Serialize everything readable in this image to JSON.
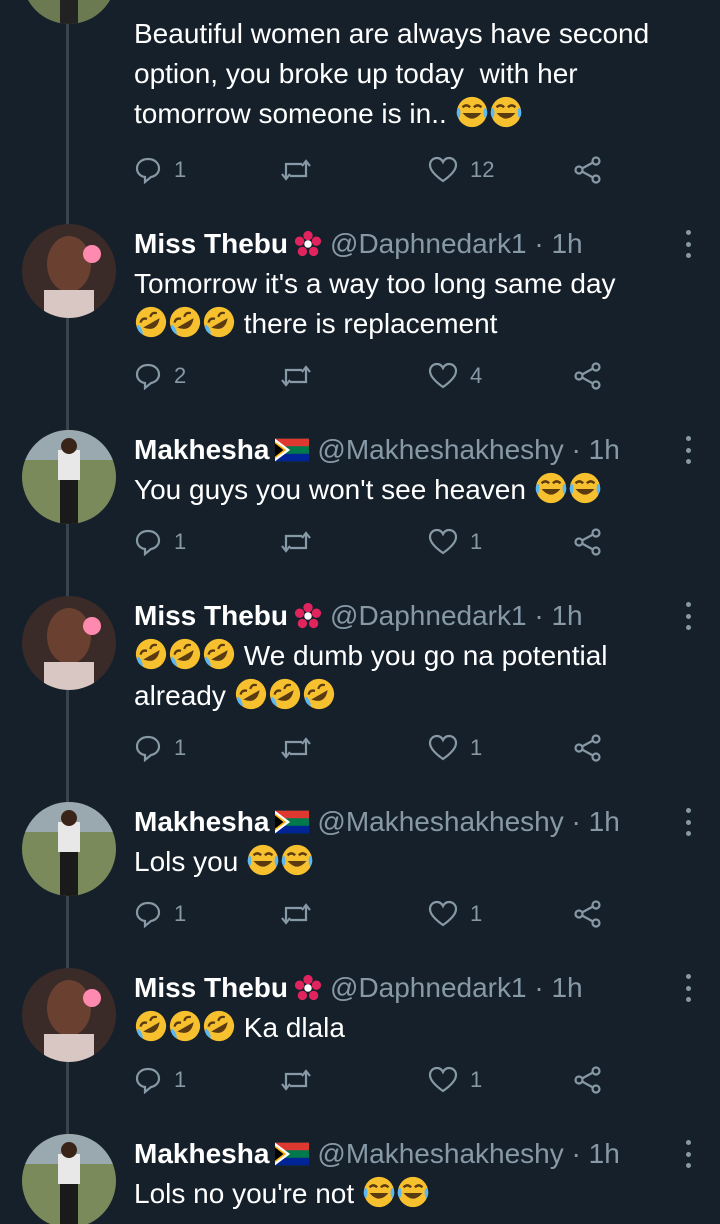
{
  "top_tweet": {
    "text_before": "Beautiful women are always have second\noption, you broke up today  with her\ntomorrow someone is in.. ",
    "emoji_after": [
      "face-with-tears-of-joy",
      "face-with-tears-of-joy"
    ],
    "replies": "1",
    "retweets": "",
    "likes": "12"
  },
  "tweets": [
    {
      "name": "Miss Thebu",
      "badge": "hibiscus-flower",
      "handle": "@Daphnedark1 · 1h",
      "line1": "Tomorrow it's a way too long same day",
      "line2_prefix_emoji": [
        "rofl",
        "rofl",
        "rofl"
      ],
      "line2_text": " there is replacement",
      "replies": "2",
      "likes": "4"
    },
    {
      "name": "Makhesha",
      "badge": "south-africa-flag",
      "handle": "@Makheshakheshy · 1h",
      "text": "You guys you won't see heaven ",
      "emoji_after": [
        "face-with-tears-of-joy",
        "face-with-tears-of-joy"
      ],
      "replies": "1",
      "likes": "1"
    },
    {
      "name": "Miss Thebu",
      "badge": "hibiscus-flower",
      "handle": "@Daphnedark1 · 1h",
      "line1_prefix_emoji": [
        "rofl",
        "rofl",
        "rofl"
      ],
      "line1_text": " We dumb you go na potential",
      "line2_text": "already ",
      "line2_emoji": [
        "rofl",
        "rofl",
        "rofl"
      ],
      "replies": "1",
      "likes": "1"
    },
    {
      "name": "Makhesha",
      "badge": "south-africa-flag",
      "handle": "@Makheshakheshy · 1h",
      "text": "Lols you ",
      "emoji_after": [
        "face-with-tears-of-joy",
        "face-with-tears-of-joy"
      ],
      "replies": "1",
      "likes": "1"
    },
    {
      "name": "Miss Thebu",
      "badge": "hibiscus-flower",
      "handle": "@Daphnedark1 · 1h",
      "prefix_emoji": [
        "rofl",
        "rofl",
        "rofl"
      ],
      "text": " Ka dlala",
      "replies": "1",
      "likes": "1"
    },
    {
      "name": "Makhesha",
      "badge": "south-africa-flag",
      "handle": "@Makheshakheshy · 1h",
      "text": "Lols no you're not ",
      "emoji_after": [
        "face-with-tears-of-joy",
        "face-with-tears-of-joy"
      ]
    }
  ],
  "colors": {
    "background": "#15202b",
    "text": "#ffffff",
    "secondary": "#8899a6",
    "thread_line": "#38444d",
    "emoji_yellow": "#f7c02f"
  }
}
